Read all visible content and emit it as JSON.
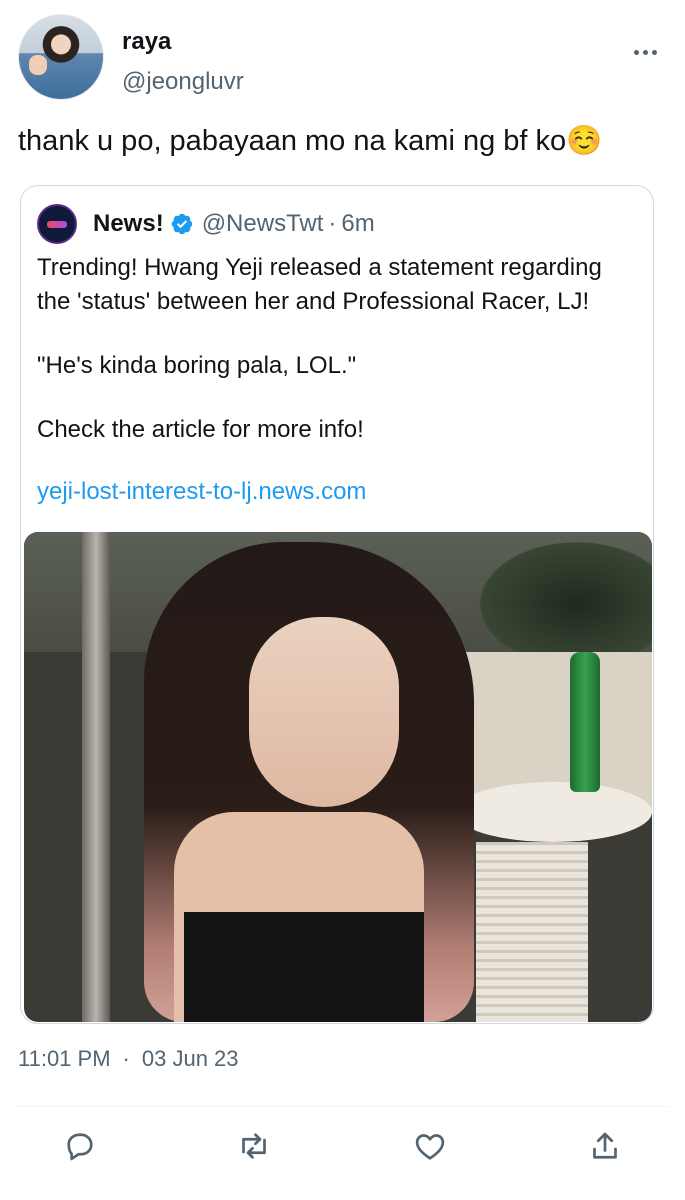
{
  "tweet": {
    "display_name": "raya",
    "handle": "@jeongluvr",
    "text": "thank u po, pabayaan mo na kami ng bf ko☺️",
    "time": "11:01 PM",
    "separator": "·",
    "date": "03 Jun 23"
  },
  "quote": {
    "name": "News!",
    "handle": "@NewsTwt",
    "separator": "·",
    "time": "6m",
    "lines": [
      "Trending! Hwang Yeji released a statement regarding",
      "the 'status' between her and Professional Racer, LJ!",
      "\"He's kinda boring pala, LOL.\"",
      "Check the article for more info!"
    ],
    "link": "yeji-lost-interest-to-lj.news.com"
  },
  "colors": {
    "text": "#0f1419",
    "secondary": "#536471",
    "link": "#1d9bf0",
    "verified": "#1d9bf0",
    "border": "#cfd9de"
  },
  "icons": {
    "more": "more-icon",
    "verified": "verified-icon",
    "reply": "reply-icon",
    "retweet": "retweet-icon",
    "like": "like-icon",
    "share": "share-icon"
  }
}
